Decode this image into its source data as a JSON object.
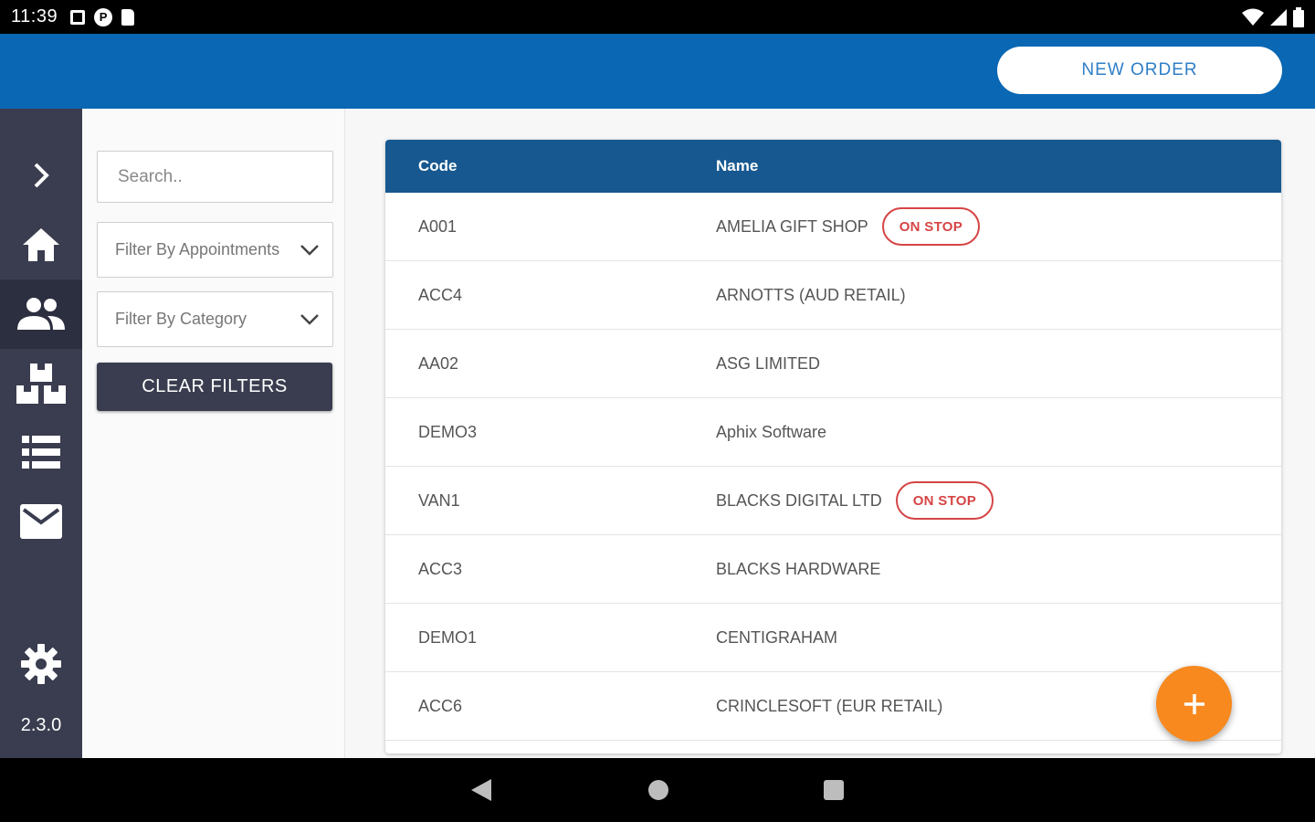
{
  "status_bar": {
    "time": "11:39",
    "p_glyph": "P"
  },
  "app_bar": {
    "new_order_label": "NEW ORDER"
  },
  "side_nav": {
    "items": [
      {
        "name": "expand",
        "icon": "chevron-right-icon"
      },
      {
        "name": "home",
        "icon": "home-icon"
      },
      {
        "name": "customers",
        "icon": "people-icon"
      },
      {
        "name": "products",
        "icon": "boxes-icon"
      },
      {
        "name": "orders",
        "icon": "list-icon"
      },
      {
        "name": "messages",
        "icon": "mail-icon"
      }
    ],
    "settings_icon": "gear-icon",
    "version": "2.3.0"
  },
  "filters": {
    "search_placeholder": "Search..",
    "appointments_label": "Filter By Appointments",
    "category_label": "Filter By Category",
    "clear_label": "CLEAR FILTERS"
  },
  "table": {
    "headers": {
      "code": "Code",
      "name": "Name"
    },
    "badge_label": "ON STOP",
    "rows": [
      {
        "code": "A001",
        "name": "AMELIA GIFT SHOP",
        "on_stop": true
      },
      {
        "code": "ACC4",
        "name": "ARNOTTS (AUD RETAIL)",
        "on_stop": false
      },
      {
        "code": "AA02",
        "name": "ASG LIMITED",
        "on_stop": false
      },
      {
        "code": "DEMO3",
        "name": "Aphix Software",
        "on_stop": false
      },
      {
        "code": "VAN1",
        "name": "BLACKS DIGITAL LTD",
        "on_stop": true
      },
      {
        "code": "ACC3",
        "name": "BLACKS HARDWARE",
        "on_stop": false
      },
      {
        "code": "DEMO1",
        "name": "CENTIGRAHAM",
        "on_stop": false
      },
      {
        "code": "ACC6",
        "name": "CRINCLESOFT (EUR RETAIL)",
        "on_stop": false
      }
    ]
  },
  "fab": {
    "label": "+"
  },
  "colors": {
    "app_bar": "#0a67b3",
    "side_nav": "#3a3d4f",
    "table_header": "#16588f",
    "badge": "#d64545",
    "fab": "#f7891f"
  }
}
